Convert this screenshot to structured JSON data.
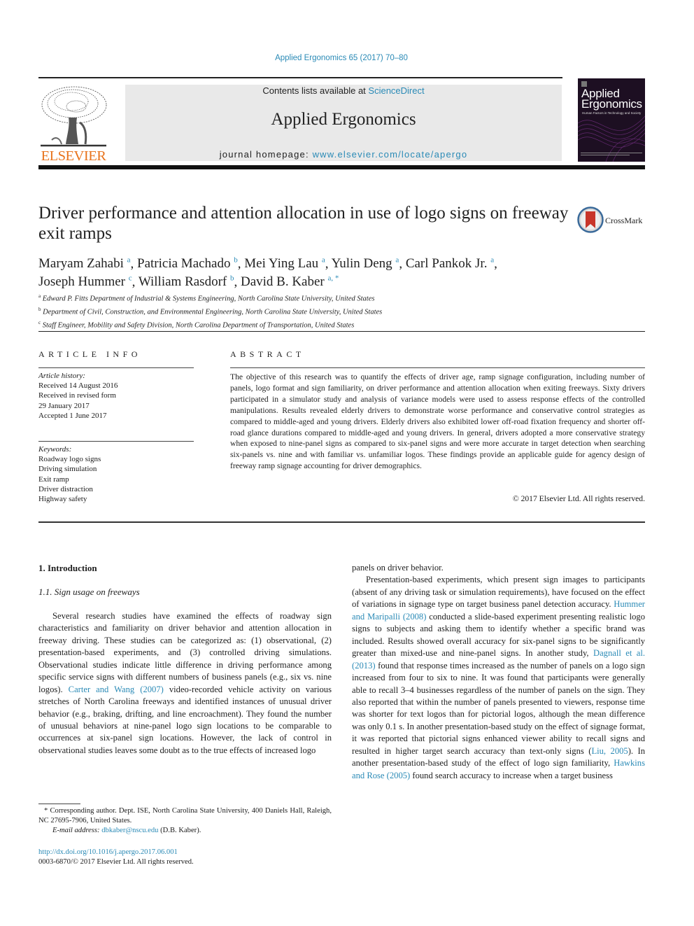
{
  "header": {
    "journal_ref": "Applied Ergonomics 65 (2017) 70–80",
    "contents_prefix": "Contents lists available at ",
    "contents_link": "ScienceDirect",
    "journal_name": "Applied Ergonomics",
    "homepage_prefix": "journal homepage: ",
    "homepage_link": "www.elsevier.com/locate/apergo",
    "publisher_logo_text": "ELSEVIER",
    "cover_title_line1": "Applied",
    "cover_title_line2": "Ergonomics",
    "cover_subtitle": "Human Factors in Technology and Society"
  },
  "colors": {
    "link": "#2a8ab6",
    "elsevier_orange": "#e8731c",
    "masthead_bg": "#e9e9e9",
    "cover_bg": "#1d0f22"
  },
  "article": {
    "title": "Driver performance and attention allocation in use of logo signs on freeway exit ramps",
    "crossmark_label": "CrossMark",
    "authors": [
      {
        "name": "Maryam Zahabi",
        "aff": "a"
      },
      {
        "name": "Patricia Machado",
        "aff": "b"
      },
      {
        "name": "Mei Ying Lau",
        "aff": "a"
      },
      {
        "name": "Yulin Deng",
        "aff": "a"
      },
      {
        "name": "Carl Pankok Jr.",
        "aff": "a"
      },
      {
        "name": "Joseph Hummer",
        "aff": "c"
      },
      {
        "name": "William Rasdorf",
        "aff": "b"
      },
      {
        "name": "David B. Kaber",
        "aff": "a, *"
      }
    ],
    "affiliations": [
      {
        "key": "a",
        "text": "Edward P. Fitts Department of Industrial & Systems Engineering, North Carolina State University, United States"
      },
      {
        "key": "b",
        "text": "Department of Civil, Construction, and Environmental Engineering, North Carolina State University, United States"
      },
      {
        "key": "c",
        "text": "Staff Engineer, Mobility and Safety Division, North Carolina Department of Transportation, United States"
      }
    ]
  },
  "article_info": {
    "heading": "ARTICLE INFO",
    "history_label": "Article history:",
    "history": [
      "Received 14 August 2016",
      "Received in revised form",
      "29 January 2017",
      "Accepted 1 June 2017"
    ],
    "keywords_label": "Keywords:",
    "keywords": [
      "Roadway logo signs",
      "Driving simulation",
      "Exit ramp",
      "Driver distraction",
      "Highway safety"
    ]
  },
  "abstract": {
    "heading": "ABSTRACT",
    "text": "The objective of this research was to quantify the effects of driver age, ramp signage configuration, including number of panels, logo format and sign familiarity, on driver performance and attention allocation when exiting freeways. Sixty drivers participated in a simulator study and analysis of variance models were used to assess response effects of the controlled manipulations. Results revealed elderly drivers to demonstrate worse performance and conservative control strategies as compared to middle-aged and young drivers. Elderly drivers also exhibited lower off-road fixation frequency and shorter off-road glance durations compared to middle-aged and young drivers. In general, drivers adopted a more conservative strategy when exposed to nine-panel signs as compared to six-panel signs and were more accurate in target detection when searching six-panels vs. nine and with familiar vs. unfamiliar logos. These findings provide an applicable guide for agency design of freeway ramp signage accounting for driver demographics.",
    "copyright": "© 2017 Elsevier Ltd. All rights reserved."
  },
  "body": {
    "section_heading": "1.  Introduction",
    "subsection_heading": "1.1.  Sign usage on freeways",
    "left_p1_a": "Several research studies have examined the effects of roadway sign characteristics and familiarity on driver behavior and attention allocation in freeway driving. These studies can be categorized as: (1) observational, (2) presentation-based experiments, and (3) controlled driving simulations. Observational studies indicate little difference in driving performance among specific service signs with different numbers of business panels (e.g., six vs. nine logos). ",
    "left_p1_link": "Carter and Wang (2007)",
    "left_p1_b": " video-recorded vehicle activity on various stretches of North Carolina freeways and identified instances of unusual driver behavior (e.g., braking, drifting, and line encroachment). They found the number of unusual behaviors at nine-panel logo sign locations to be comparable to occurrences at six-panel sign locations. However, the lack of control in observational studies leaves some doubt as to the true effects of increased logo",
    "right_p0": "panels on driver behavior.",
    "right_p1_a": "Presentation-based experiments, which present sign images to participants (absent of any driving task or simulation requirements), have focused on the effect of variations in signage type on target business panel detection accuracy. ",
    "right_p1_link1": "Hummer and Maripalli (2008)",
    "right_p1_b": " conducted a slide-based experiment presenting realistic logo signs to subjects and asking them to identify whether a specific brand was included. Results showed overall accuracy for six-panel signs to be significantly greater than mixed-use and nine-panel signs. In another study, ",
    "right_p1_link2": "Dagnall et al. (2013)",
    "right_p1_c": " found that response times increased as the number of panels on a logo sign increased from four to six to nine. It was found that participants were generally able to recall 3–4 businesses regardless of the number of panels on the sign. They also reported that within the number of panels presented to viewers, response time was shorter for text logos than for pictorial logos, although the mean difference was only 0.1 s. In another presentation-based study on the effect of signage format, it was reported that pictorial signs enhanced viewer ability to recall signs and resulted in higher target search accuracy than text-only signs (",
    "right_p1_link3": "Liu, 2005",
    "right_p1_d": "). In another presentation-based study of the effect of logo sign familiarity, ",
    "right_p1_link4": "Hawkins and Rose (2005)",
    "right_p1_e": " found search accuracy to increase when a target business"
  },
  "footnotes": {
    "corresponding": "* Corresponding author. Dept. ISE, North Carolina State University, 400 Daniels Hall, Raleigh, NC 27695-7906, United States.",
    "email_label": "E-mail address: ",
    "email": "dbkaber@nscu.edu",
    "email_suffix": " (D.B. Kaber).",
    "doi": "http://dx.doi.org/10.1016/j.apergo.2017.06.001",
    "issn_copyright": "0003-6870/© 2017 Elsevier Ltd. All rights reserved."
  }
}
